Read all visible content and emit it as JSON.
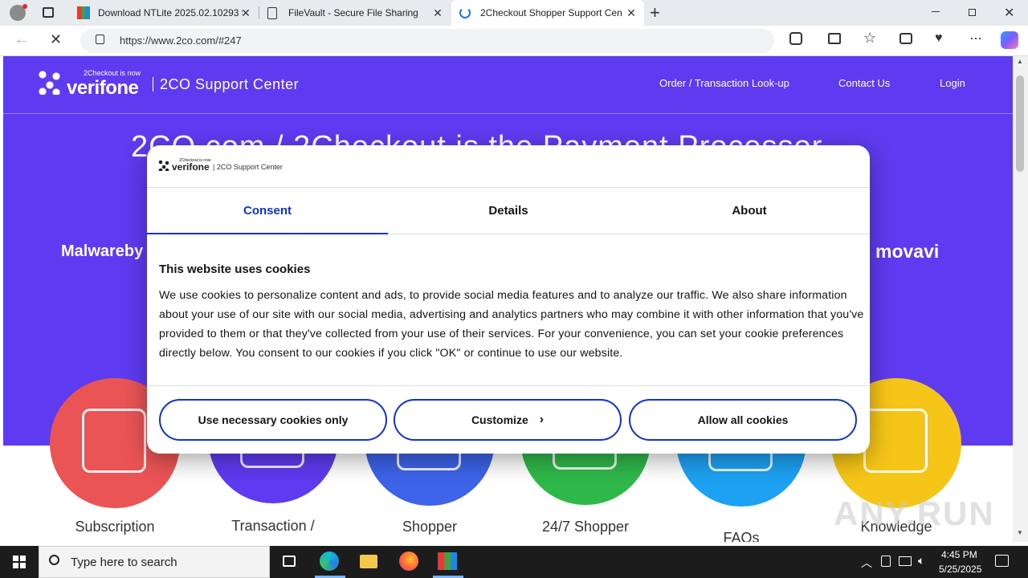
{
  "browser": {
    "tabs": [
      {
        "title": "Download NTLite 2025.02.10293 f",
        "active": false
      },
      {
        "title": "FileVault - Secure File Sharing",
        "active": false
      },
      {
        "title": "2Checkout Shopper Support Cen",
        "active": true
      }
    ],
    "url": "https://www.2co.com/#247"
  },
  "site": {
    "logo_small": "2Checkout is now",
    "logo_main": "verifone",
    "center_title": "2CO Support Center",
    "nav": [
      "Order / Transaction Look-up",
      "Contact Us",
      "Login"
    ],
    "hero_heading": "2CO.com / 2Checkout is the Payment Processor",
    "brand_left": "Malwareby",
    "brand_right": "movavi",
    "categories": [
      {
        "label": "Subscription",
        "color": "#ea5455"
      },
      {
        "label": "Transaction /",
        "color": "#5e3bf0"
      },
      {
        "label": "Shopper",
        "color": "#3d63e8"
      },
      {
        "label": "24/7 Shopper",
        "color": "#2fb84a"
      },
      {
        "label": "FAQs",
        "color": "#1da1f2"
      },
      {
        "label": "Knowledge",
        "color": "#f5c518"
      }
    ]
  },
  "consent": {
    "logo_small": "2Checkout is now",
    "logo_main": "verifone",
    "logo_suffix": "| 2CO Support Center",
    "tabs": [
      "Consent",
      "Details",
      "About"
    ],
    "heading": "This website uses cookies",
    "body": "We use cookies to personalize content and ads, to provide social media features and to analyze our traffic. We also share information about your use of our site with our social media, advertising and analytics partners who may combine it with other information that you've provided to them or that they've collected from your use of their services. For your convenience, you can set your cookie preferences directly below. You consent to our cookies if you click \"OK\" or continue to use our website.",
    "buttons": [
      "Use necessary cookies only",
      "Customize",
      "Allow all cookies"
    ]
  },
  "watermark": "ANY.RUN",
  "taskbar": {
    "search_placeholder": "Type here to search",
    "time": "4:45 PM",
    "date": "5/25/2025"
  },
  "colors": {
    "hero": "#5e3bf0",
    "accent": "#1032cf"
  }
}
